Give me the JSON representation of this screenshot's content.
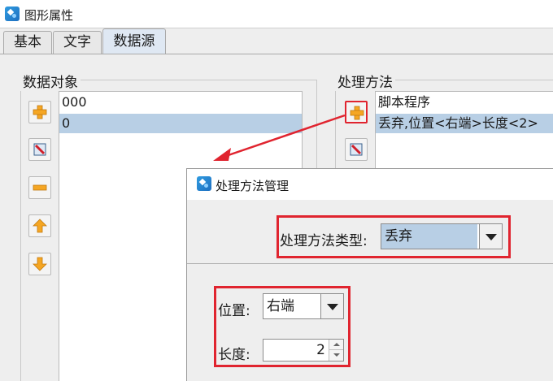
{
  "window": {
    "title": "图形属性"
  },
  "tabs": [
    {
      "label": "基本"
    },
    {
      "label": "文字"
    },
    {
      "label": "数据源",
      "active": true
    }
  ],
  "data_objects": {
    "title": "数据对象",
    "items": [
      "000",
      "0"
    ],
    "selected_index": 1
  },
  "processing_methods": {
    "title": "处理方法",
    "items": [
      "脚本程序",
      "丢弃,位置<右端>长度<2>"
    ],
    "selected_index": 1
  },
  "popup": {
    "title": "处理方法管理",
    "method_type_label": "处理方法类型:",
    "method_type_value": "丢弃",
    "position_label": "位置:",
    "position_value": "右端",
    "length_label": "长度:",
    "length_value": "2"
  },
  "colors": {
    "highlight_red": "#e0242f",
    "selection_blue": "#b8cfe5",
    "add_icon_orange": "#f5a623"
  }
}
